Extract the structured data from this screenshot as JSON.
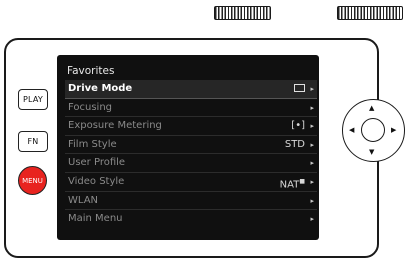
{
  "buttons": {
    "play": "PLAY",
    "fn": "FN",
    "menu": "MENU"
  },
  "screen": {
    "title": "Favorites",
    "items": [
      {
        "label": "Drive Mode",
        "value": "",
        "selected": true
      },
      {
        "label": "Focusing",
        "value": ""
      },
      {
        "label": "Exposure Metering",
        "value": "[•]"
      },
      {
        "label": "Film Style",
        "value": "STD"
      },
      {
        "label": "User Profile",
        "value": ""
      },
      {
        "label": "Video Style",
        "value": "NAT"
      },
      {
        "label": "WLAN",
        "value": ""
      },
      {
        "label": "Main Menu",
        "value": ""
      }
    ]
  },
  "colors": {
    "menu_button": "#e8231f",
    "screen_background": "#101010",
    "selected_row": "#262626"
  }
}
